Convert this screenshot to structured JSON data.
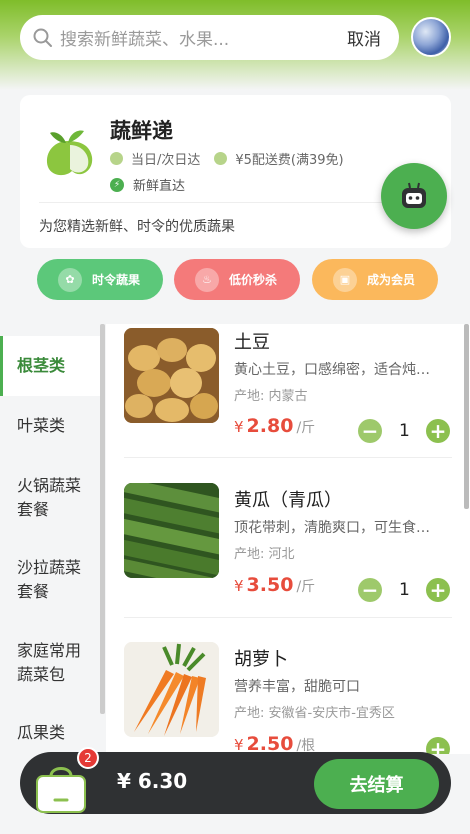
{
  "search": {
    "placeholder": "搜索新鲜蔬菜、水果...",
    "cancel_label": "取消"
  },
  "shop": {
    "name": "蔬鲜递",
    "delivery_time": "当日/次日达",
    "delivery_fee": "¥5配送费(满39免)",
    "tag": "新鲜直达",
    "description": "为您精选新鲜、时令的优质蔬果"
  },
  "quick_actions": [
    {
      "label": "时令蔬果",
      "color": "#5cc87a"
    },
    {
      "label": "低价秒杀",
      "color": "#f47a7a"
    },
    {
      "label": "成为会员",
      "color": "#fbb85c"
    }
  ],
  "categories": [
    {
      "label": "根茎类",
      "active": true
    },
    {
      "label": "叶菜类",
      "active": false
    },
    {
      "label": "火锅蔬菜套餐",
      "active": false
    },
    {
      "label": "沙拉蔬菜套餐",
      "active": false
    },
    {
      "label": "家庭常用蔬菜包",
      "active": false
    },
    {
      "label": "瓜果类",
      "active": false
    }
  ],
  "category_lines": {
    "c3a": "火锅蔬菜",
    "c3b": "套餐",
    "c4a": "沙拉蔬菜",
    "c4b": "套餐",
    "c5a": "家庭常用",
    "c5b": "蔬菜包"
  },
  "products": [
    {
      "name": "土豆",
      "desc": "黄心土豆，口感绵密，适合炖…",
      "origin": "产地: 内蒙古",
      "currency": "¥",
      "price": "2.80",
      "unit": "/斤",
      "qty": "1"
    },
    {
      "name": "黄瓜（青瓜）",
      "desc": "顶花带刺，清脆爽口，可生食…",
      "origin": "产地: 河北",
      "currency": "¥",
      "price": "3.50",
      "unit": "/斤",
      "qty": "1"
    },
    {
      "name": "胡萝卜",
      "desc": "营养丰富，甜脆可口",
      "origin": "产地: 安徽省-安庆市-宜秀区",
      "currency": "¥",
      "price": "2.50",
      "unit": "/根",
      "qty": ""
    }
  ],
  "cart": {
    "badge": "2",
    "total": "¥ 6.30",
    "checkout_label": "去结算"
  },
  "colors": {
    "brand": "#4caf50",
    "price": "#e74c3c",
    "cart_bg": "#2f3133"
  }
}
